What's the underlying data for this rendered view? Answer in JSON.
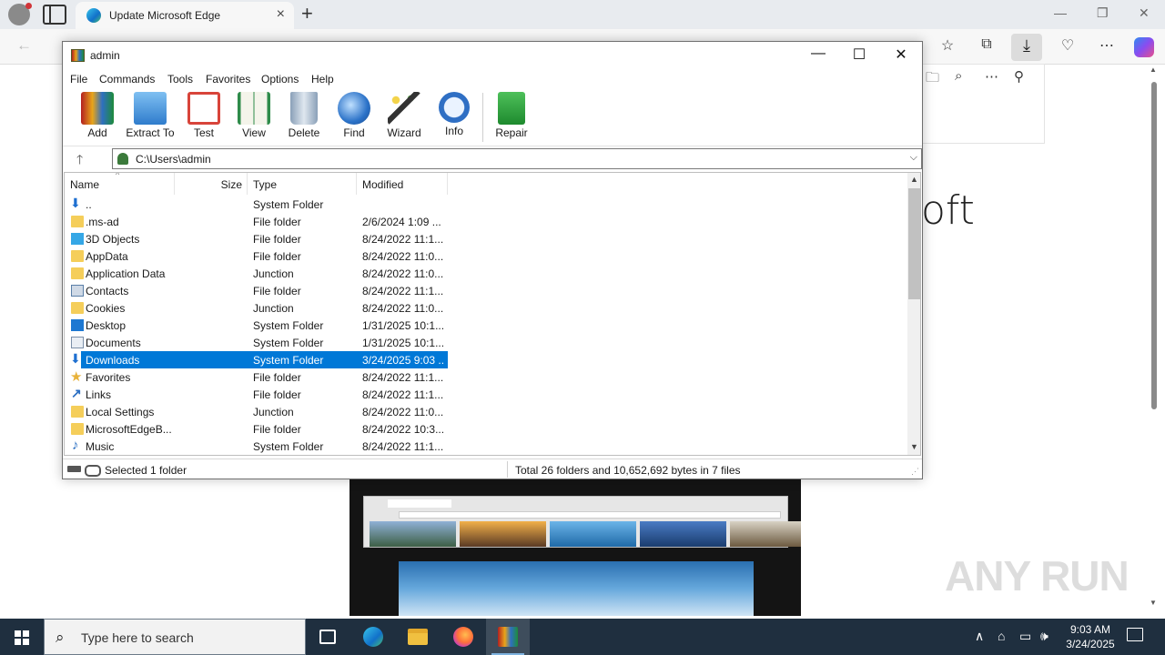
{
  "edge": {
    "tab_title": "Update Microsoft Edge",
    "page_heading_fragment": "oft",
    "watermark": "ANY RUN"
  },
  "winrar": {
    "title": "admin",
    "menu": [
      "File",
      "Commands",
      "Tools",
      "Favorites",
      "Options",
      "Help"
    ],
    "toolbar": [
      {
        "label": "Add",
        "icon": "add-archive-icon",
        "color": "#c0392b"
      },
      {
        "label": "Extract To",
        "icon": "extract-folder-icon",
        "color": "#3b8ed8"
      },
      {
        "label": "Test",
        "icon": "test-clipboard-icon",
        "color": "#d8443a"
      },
      {
        "label": "View",
        "icon": "view-book-icon",
        "color": "#2e8b4a"
      },
      {
        "label": "Delete",
        "icon": "delete-bin-icon",
        "color": "#8aa0b8"
      },
      {
        "label": "Find",
        "icon": "find-magnifier-icon",
        "color": "#2b72c8"
      },
      {
        "label": "Wizard",
        "icon": "wizard-wand-icon",
        "color": "#5aa04a"
      },
      {
        "label": "Info",
        "icon": "info-icon",
        "color": "#2f6fc4"
      },
      {
        "label": "Repair",
        "icon": "repair-kit-icon",
        "color": "#2a9a3a"
      }
    ],
    "address": "C:\\Users\\admin",
    "columns": {
      "name": "Name",
      "size": "Size",
      "type": "Type",
      "modified": "Modified"
    },
    "rows": [
      {
        "name": "..",
        "size": "",
        "type": "System Folder",
        "modified": "",
        "icon": "updir"
      },
      {
        "name": ".ms-ad",
        "size": "",
        "type": "File folder",
        "modified": "2/6/2024 1:09 ...",
        "icon": "folder"
      },
      {
        "name": "3D Objects",
        "size": "",
        "type": "File folder",
        "modified": "8/24/2022 11:1...",
        "icon": "3d"
      },
      {
        "name": "AppData",
        "size": "",
        "type": "File folder",
        "modified": "8/24/2022 11:0...",
        "icon": "folder"
      },
      {
        "name": "Application Data",
        "size": "",
        "type": "Junction",
        "modified": "8/24/2022 11:0...",
        "icon": "folder"
      },
      {
        "name": "Contacts",
        "size": "",
        "type": "File folder",
        "modified": "8/24/2022 11:1...",
        "icon": "contacts"
      },
      {
        "name": "Cookies",
        "size": "",
        "type": "Junction",
        "modified": "8/24/2022 11:0...",
        "icon": "folder"
      },
      {
        "name": "Desktop",
        "size": "",
        "type": "System Folder",
        "modified": "1/31/2025 10:1...",
        "icon": "desktop"
      },
      {
        "name": "Documents",
        "size": "",
        "type": "System Folder",
        "modified": "1/31/2025 10:1...",
        "icon": "docs"
      },
      {
        "name": "Downloads",
        "size": "",
        "type": "System Folder",
        "modified": "3/24/2025 9:03 ...",
        "icon": "download",
        "selected": true
      },
      {
        "name": "Favorites",
        "size": "",
        "type": "File folder",
        "modified": "8/24/2022 11:1...",
        "icon": "fav"
      },
      {
        "name": "Links",
        "size": "",
        "type": "File folder",
        "modified": "8/24/2022 11:1...",
        "icon": "links"
      },
      {
        "name": "Local Settings",
        "size": "",
        "type": "Junction",
        "modified": "8/24/2022 11:0...",
        "icon": "folder"
      },
      {
        "name": "MicrosoftEdgeB...",
        "size": "",
        "type": "File folder",
        "modified": "8/24/2022 10:3...",
        "icon": "folder"
      },
      {
        "name": "Music",
        "size": "",
        "type": "System Folder",
        "modified": "8/24/2022 11:1...",
        "icon": "music"
      }
    ],
    "status_left": "Selected 1 folder",
    "status_right": "Total 26 folders and 10,652,692 bytes in 7 files"
  },
  "taskbar": {
    "search_placeholder": "Type here to search",
    "time": "9:03 AM",
    "date": "3/24/2025"
  }
}
